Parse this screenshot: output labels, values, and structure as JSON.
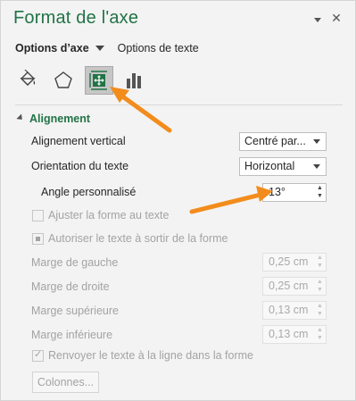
{
  "pane": {
    "title": "Format de l'axe",
    "collapse_icon": "chevron-down-icon",
    "close_glyph": "✕"
  },
  "tabs": {
    "active_label": "Options d’axe",
    "other_label": "Options de texte"
  },
  "icon_tabs": [
    {
      "name": "fill-line-icon"
    },
    {
      "name": "effects-icon"
    },
    {
      "name": "size-properties-icon",
      "selected": true
    },
    {
      "name": "axis-options-icon"
    }
  ],
  "alignment": {
    "section_label": "Alignement",
    "vertical_label": "Alignement vertical",
    "vertical_value": "Centré par...",
    "orientation_label": "Orientation du texte",
    "orientation_value": "Horizontal",
    "angle_label": "Angle personnalisé",
    "angle_value": "13°",
    "fit_label": "Ajuster la forme au texte",
    "overflow_label": "Autoriser le texte à sortir de la forme",
    "margin_left_label": "Marge de gauche",
    "margin_left_value": "0,25 cm",
    "margin_right_label": "Marge de droite",
    "margin_right_value": "0,25 cm",
    "margin_top_label": "Marge supérieure",
    "margin_top_value": "0,13 cm",
    "margin_bottom_label": "Marge inférieure",
    "margin_bottom_value": "0,13 cm",
    "wrap_label": "Renvoyer le texte à la ligne dans la forme",
    "columns_label": "Colonnes..."
  },
  "colors": {
    "accent_green": "#217346",
    "annotation_orange": "#f28c1c"
  }
}
